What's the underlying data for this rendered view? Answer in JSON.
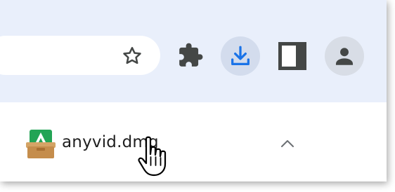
{
  "toolbar": {
    "bookmark_icon": "star-outline-icon",
    "extensions_icon": "puzzle-piece-icon",
    "downloads_icon": "download-icon",
    "side_panel_icon": "side-panel-icon",
    "profile_icon": "person-icon"
  },
  "downloads": {
    "items": [
      {
        "file_name": "anyvid.dmg",
        "file_icon": "dmg-package-icon",
        "expand_icon": "chevron-up-icon"
      }
    ]
  },
  "colors": {
    "toolbar_bg": "#e9effb",
    "omnibox_bg": "#ffffff",
    "download_button_bg": "#d3dced",
    "download_icon": "#1a73e8",
    "icon_gray": "#444746",
    "avatar_bg": "#d8dde6"
  },
  "cursor": "hand-pointer-icon"
}
